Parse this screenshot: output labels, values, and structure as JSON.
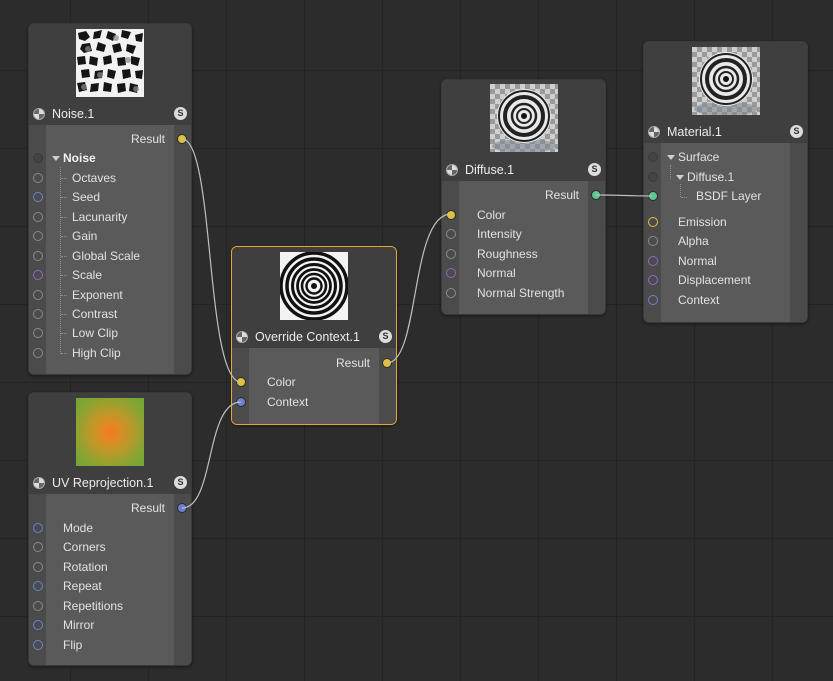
{
  "colors": {
    "background": "#2c2c2c",
    "node_body": "#5a5a5a",
    "node_header": "#3f3f3f",
    "selected_outline": "#e2a92e",
    "port_yellow": "#e0c13c",
    "port_blue": "#6a80d2",
    "port_purple": "#9862c6",
    "port_green": "#5cc88c",
    "port_gray": "#9b9b9b"
  },
  "nodes": {
    "noise": {
      "title": "Noise.1",
      "badge": "S",
      "output_label": "Result",
      "group_label": "Noise",
      "params": [
        "Octaves",
        "Seed",
        "Lacunarity",
        "Gain",
        "Global Scale",
        "Scale",
        "Exponent",
        "Contrast",
        "Low Clip",
        "High Clip"
      ]
    },
    "uv": {
      "title": "UV Reprojection.1",
      "badge": "S",
      "output_label": "Result",
      "params": [
        "Mode",
        "Corners",
        "Rotation",
        "Repeat",
        "Repetitions",
        "Mirror",
        "Flip"
      ]
    },
    "override": {
      "title": "Override Context.1",
      "badge": "S",
      "output_label": "Result",
      "params": [
        "Color",
        "Context"
      ]
    },
    "diffuse": {
      "title": "Diffuse.1",
      "badge": "S",
      "output_label": "Result",
      "params": [
        "Color",
        "Intensity",
        "Roughness",
        "Normal",
        "Normal Strength"
      ]
    },
    "material": {
      "title": "Material.1",
      "badge": "S",
      "surface_label": "Surface",
      "diffuse_label": "Diffuse.1",
      "bsdf_label": "BSDF Layer",
      "params": [
        "Emission",
        "Alpha",
        "Normal",
        "Displacement",
        "Context"
      ]
    }
  },
  "icons": {
    "node_type": "checker-sphere-icon",
    "solo": "s-badge-icon",
    "expand": "triangle-down-icon"
  }
}
